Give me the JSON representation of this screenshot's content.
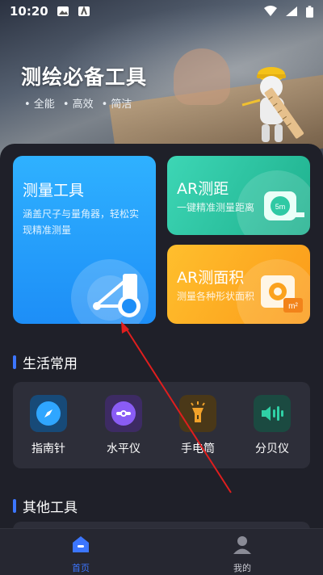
{
  "status_bar": {
    "time": "10:20"
  },
  "hero": {
    "title": "测绘必备工具",
    "tags": [
      "• 全能",
      "• 高效",
      "• 简洁"
    ]
  },
  "cards": {
    "measure": {
      "title": "测量工具",
      "subtitle": "涵盖尺子与量角器，轻松实现精准测量"
    },
    "ar_distance": {
      "title": "AR测距",
      "subtitle": "一键精准测量距离"
    },
    "ar_area": {
      "title": "AR测面积",
      "subtitle": "测量各种形状面积"
    }
  },
  "life_section": {
    "title": "生活常用",
    "items": [
      {
        "label": "指南针",
        "icon": "compass-icon",
        "bg": "#174a78",
        "fg": "#2fa6ff"
      },
      {
        "label": "水平仪",
        "icon": "level-icon",
        "bg": "#3d2b63",
        "fg": "#8a5cf5"
      },
      {
        "label": "手电筒",
        "icon": "flashlight-icon",
        "bg": "#4a3818",
        "fg": "#f2a22a"
      },
      {
        "label": "分贝仪",
        "icon": "decibel-icon",
        "bg": "#1b4a41",
        "fg": "#2fd1a6"
      }
    ]
  },
  "other_section": {
    "title": "其他工具"
  },
  "tabbar": {
    "home": "首页",
    "mine": "我的"
  },
  "colors": {
    "accent": "#3c76ff",
    "arrow": "#e01e1e"
  }
}
